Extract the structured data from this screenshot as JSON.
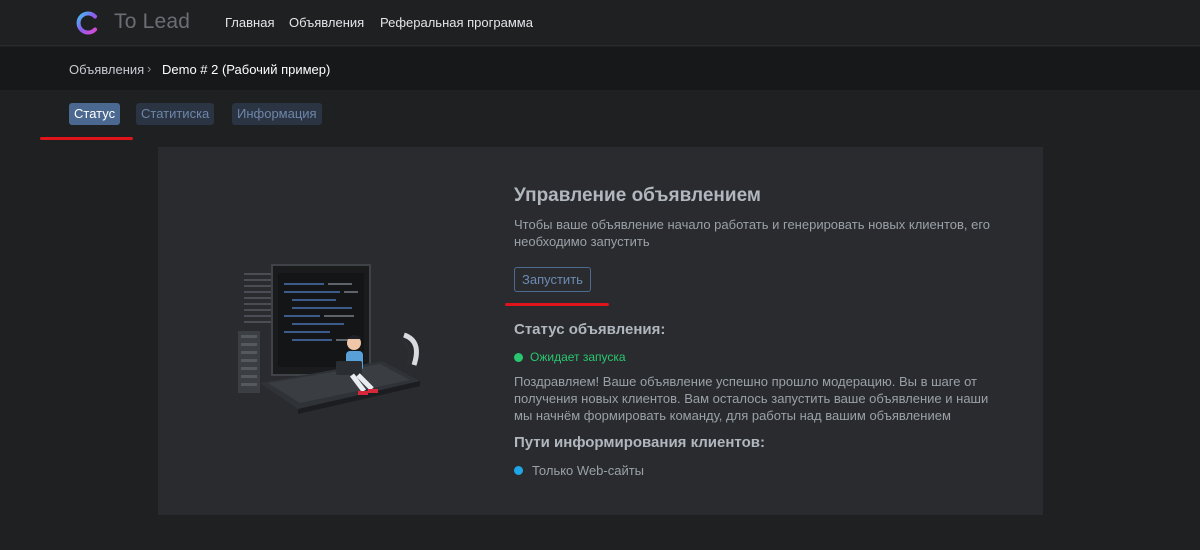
{
  "header": {
    "brand": "To Lead",
    "nav": {
      "home": "Главная",
      "ads": "Объявления",
      "referral": "Реферальная программа"
    }
  },
  "breadcrumb": {
    "parent": "Объявления",
    "separator": "›",
    "current": "Demo # 2 (Рабочий пример)"
  },
  "tabs": [
    {
      "label": "Статус",
      "active": true
    },
    {
      "label": "Статитиска",
      "active": false
    },
    {
      "label": "Информация",
      "active": false
    }
  ],
  "main": {
    "title": "Управление объявлением",
    "description": "Чтобы ваше объявление начало работать и генерировать новых клиентов, его необходимо запустить",
    "launch_button": "Запустить",
    "status_heading": "Статус объявления:",
    "status_text": "Ожидает запуска",
    "congrats": "Поздравляем! Ваше объявление успешно прошло модерацию. Вы в шаге от получения новых клиентов. Вам осталось запустить ваше объявление и наши мы начнём формировать команду, для работы над вашим объявлением",
    "paths_heading": "Пути информирования клиентов:",
    "paths": [
      "Только Web-сайты"
    ]
  },
  "colors": {
    "accent": "#4a6890",
    "status_green": "#28c76f",
    "path_blue": "#1fa6e8",
    "highlight_red": "#e0141b"
  },
  "icons": {
    "logo": "to-lead-logo-icon",
    "separator": "chevron-right-icon"
  }
}
